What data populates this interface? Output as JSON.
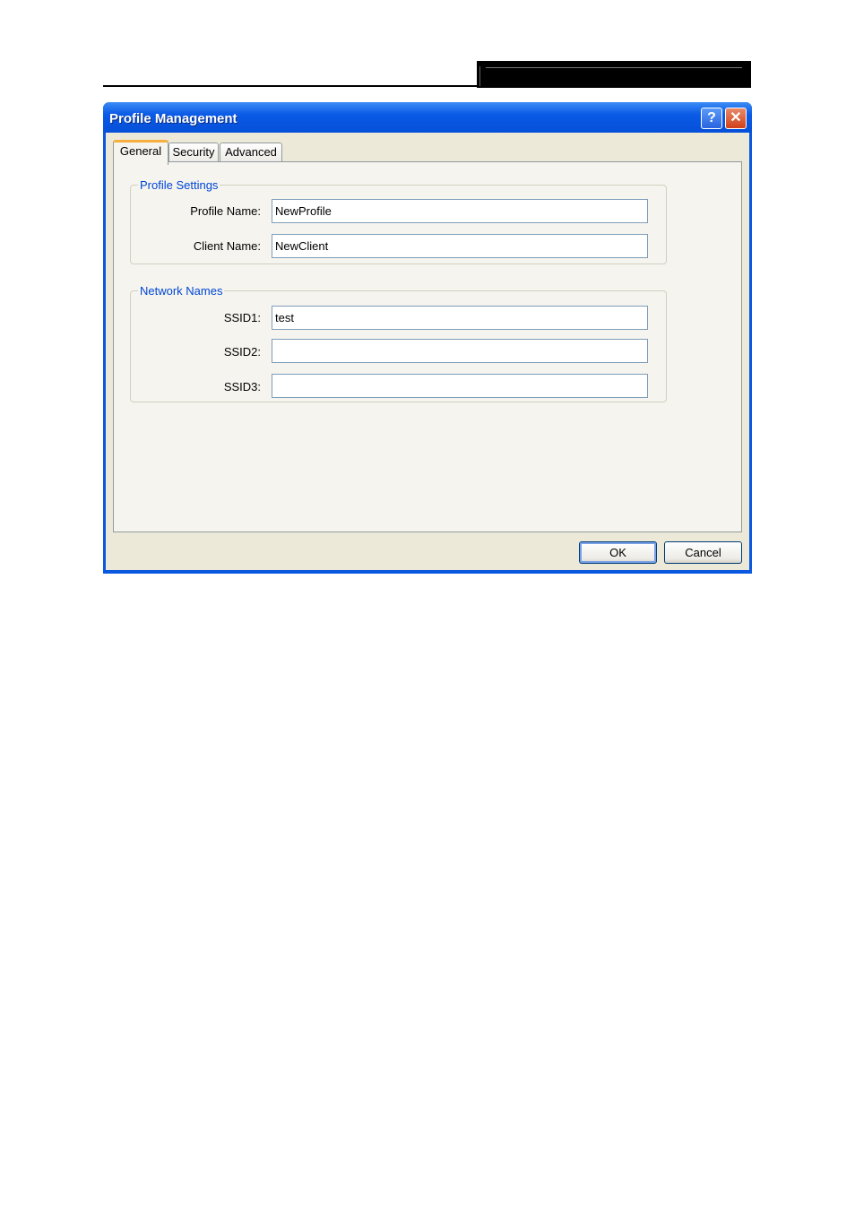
{
  "window": {
    "title": "Profile Management",
    "help_icon": "help-icon",
    "close_icon": "close-icon"
  },
  "tabs": [
    {
      "label": "General",
      "active": true
    },
    {
      "label": "Security"
    },
    {
      "label": "Advanced"
    }
  ],
  "profile_settings": {
    "legend": "Profile Settings",
    "profile_name_label": "Profile Name:",
    "profile_name_value": "NewProfile",
    "client_name_label": "Client Name:",
    "client_name_value": "NewClient"
  },
  "network_names": {
    "legend": "Network Names",
    "ssid1_label": "SSID1:",
    "ssid1_value": "test",
    "ssid2_label": "SSID2:",
    "ssid2_value": "",
    "ssid3_label": "SSID3:",
    "ssid3_value": ""
  },
  "buttons": {
    "ok": "OK",
    "cancel": "Cancel"
  },
  "colors": {
    "titlebar": "#0a5ae6",
    "accent": "#0046d5"
  }
}
